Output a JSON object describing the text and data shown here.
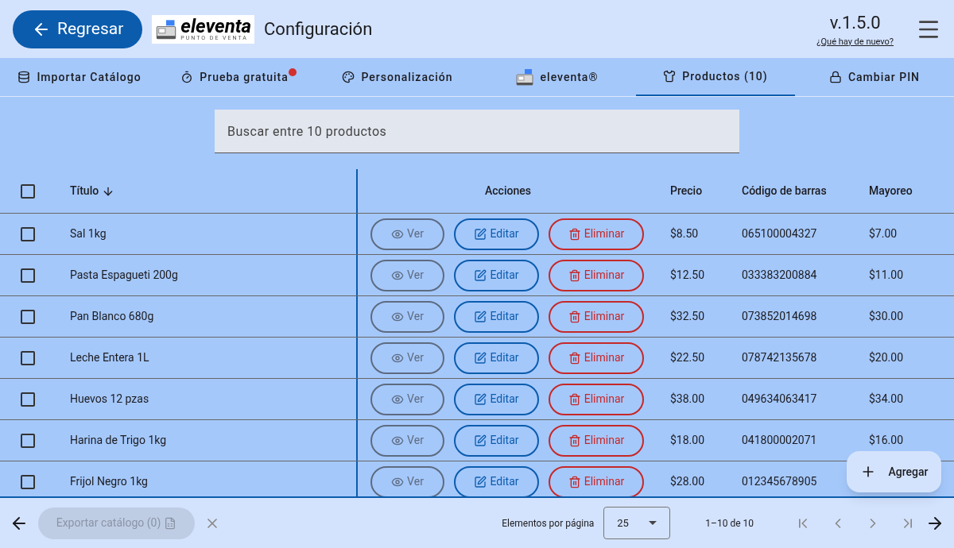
{
  "header": {
    "back_button": "Regresar",
    "logo": {
      "name": "eleventa",
      "tagline": "PUNTO DE VENTA"
    },
    "title": "Configuración",
    "version": "v.1.5.0",
    "whats_new_link": "¿Qué hay de nuevo?"
  },
  "tabs": [
    {
      "label": "Importar Catálogo",
      "kind": "database",
      "selected": false,
      "alert": false
    },
    {
      "label": "Prueba gratuita",
      "kind": "timer",
      "selected": false,
      "alert": true
    },
    {
      "label": "Personalización",
      "kind": "palette",
      "selected": false,
      "alert": false
    },
    {
      "label": "eleventa®",
      "kind": "logo",
      "selected": false,
      "alert": false
    },
    {
      "label": "Productos (10)",
      "kind": "shirt",
      "selected": true,
      "alert": false
    },
    {
      "label": "Cambiar PIN",
      "kind": "lock",
      "selected": false,
      "alert": false
    }
  ],
  "search": {
    "placeholder": "Buscar entre 10 productos"
  },
  "table": {
    "select_all_checked": false,
    "columns": [
      "Título",
      "Acciones",
      "Precio",
      "Código de barras",
      "Mayoreo"
    ],
    "rows": [
      {
        "title": "Sal 1kg",
        "actions": [
          "Ver",
          "Editar",
          "Eliminar"
        ],
        "price": "$8.50",
        "barcode": "065100004327",
        "wholesale": "$7.00",
        "checked": false
      },
      {
        "title": "Pasta Espagueti 200g",
        "actions": [
          "Ver",
          "Editar",
          "Eliminar"
        ],
        "price": "$12.50",
        "barcode": "033383200884",
        "wholesale": "$11.00",
        "checked": false
      },
      {
        "title": "Pan Blanco 680g",
        "actions": [
          "Ver",
          "Editar",
          "Eliminar"
        ],
        "price": "$32.50",
        "barcode": "073852014698",
        "wholesale": "$30.00",
        "checked": false
      },
      {
        "title": "Leche Entera 1L",
        "actions": [
          "Ver",
          "Editar",
          "Eliminar"
        ],
        "price": "$22.50",
        "barcode": "078742135678",
        "wholesale": "$20.00",
        "checked": false
      },
      {
        "title": "Huevos 12 pzas",
        "actions": [
          "Ver",
          "Editar",
          "Eliminar"
        ],
        "price": "$38.00",
        "barcode": "049634063417",
        "wholesale": "$34.00",
        "checked": false
      },
      {
        "title": "Harina de Trigo 1kg",
        "actions": [
          "Ver",
          "Editar",
          "Eliminar"
        ],
        "price": "$18.00",
        "barcode": "041800002071",
        "wholesale": "$16.00",
        "checked": false
      },
      {
        "title": "Frijol Negro 1kg",
        "actions": [
          "Ver",
          "Editar",
          "Eliminar"
        ],
        "price": "$28.00",
        "barcode": "012345678905",
        "checked": false
      }
    ]
  },
  "add_button": "Agregar",
  "footer": {
    "export_button": {
      "label": "Exportar catálogo (0)",
      "disabled": true
    },
    "per_page_label": "Elementos por página",
    "per_page": "25",
    "range": "1–10 de 10"
  }
}
